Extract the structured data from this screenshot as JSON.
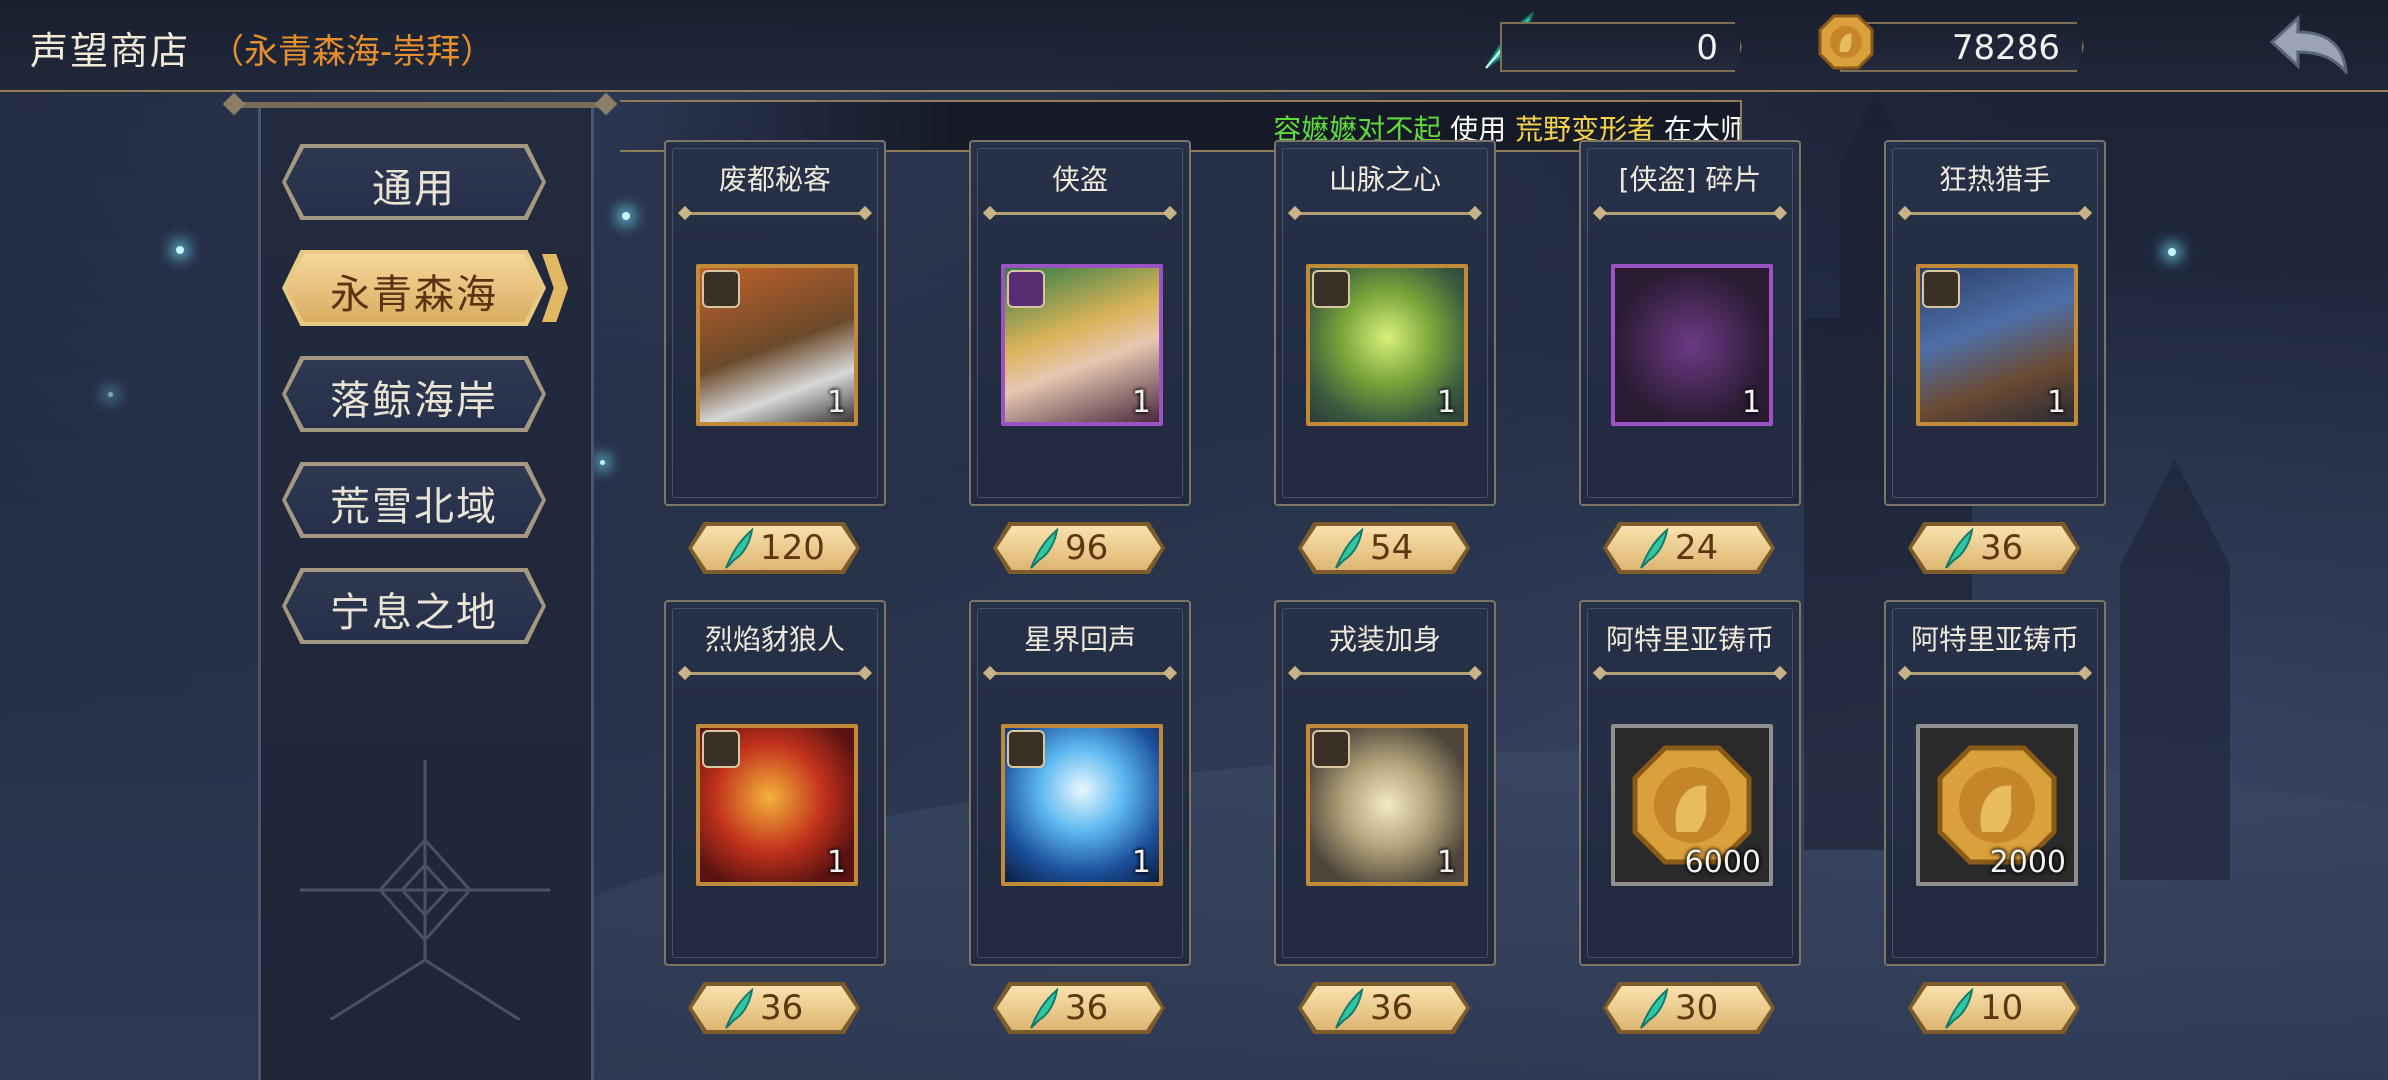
{
  "header": {
    "title": "声望商店",
    "subtitle": "（永青森海-崇拜）",
    "feather_count": "0",
    "gold_count": "78286"
  },
  "ticker": {
    "player": "容嬷嬷对不起",
    "verb": "使用",
    "item": "荒野变形者",
    "tail": "在大师"
  },
  "tabs": [
    {
      "label": "通用",
      "active": false
    },
    {
      "label": "永青森海",
      "active": true
    },
    {
      "label": "落鲸海岸",
      "active": false
    },
    {
      "label": "荒雪北域",
      "active": false
    },
    {
      "label": "宁息之地",
      "active": false
    }
  ],
  "items": [
    {
      "name": "废都秘客",
      "qty": "1",
      "price": "120",
      "frame": "orange"
    },
    {
      "name": "侠盗",
      "qty": "1",
      "price": "96",
      "frame": "purple"
    },
    {
      "name": "山脉之心",
      "qty": "1",
      "price": "54",
      "frame": "orange"
    },
    {
      "name": "[侠盗] 碎片",
      "qty": "1",
      "price": "24",
      "frame": "purple"
    },
    {
      "name": "狂热猎手",
      "qty": "1",
      "price": "36",
      "frame": "orange"
    },
    {
      "name": "烈焰豺狼人",
      "qty": "1",
      "price": "36",
      "frame": "orange"
    },
    {
      "name": "星界回声",
      "qty": "1",
      "price": "36",
      "frame": "orange"
    },
    {
      "name": "戎装加身",
      "qty": "1",
      "price": "36",
      "frame": "orange"
    },
    {
      "name": "阿特里亚铸币",
      "qty": "6000",
      "price": "30",
      "frame": "gray"
    },
    {
      "name": "阿特里亚铸币",
      "qty": "2000",
      "price": "10",
      "frame": "gray"
    }
  ],
  "colors": {
    "accent_orange": "#e58f2f",
    "ticker_green": "#5fdc3c",
    "ticker_gold": "#f5d24b",
    "gold_button": "#f4d79a"
  },
  "icons": {
    "currency_feather": "feather-icon",
    "currency_gold": "gold-coin-icon",
    "back": "back-arrow-icon"
  }
}
